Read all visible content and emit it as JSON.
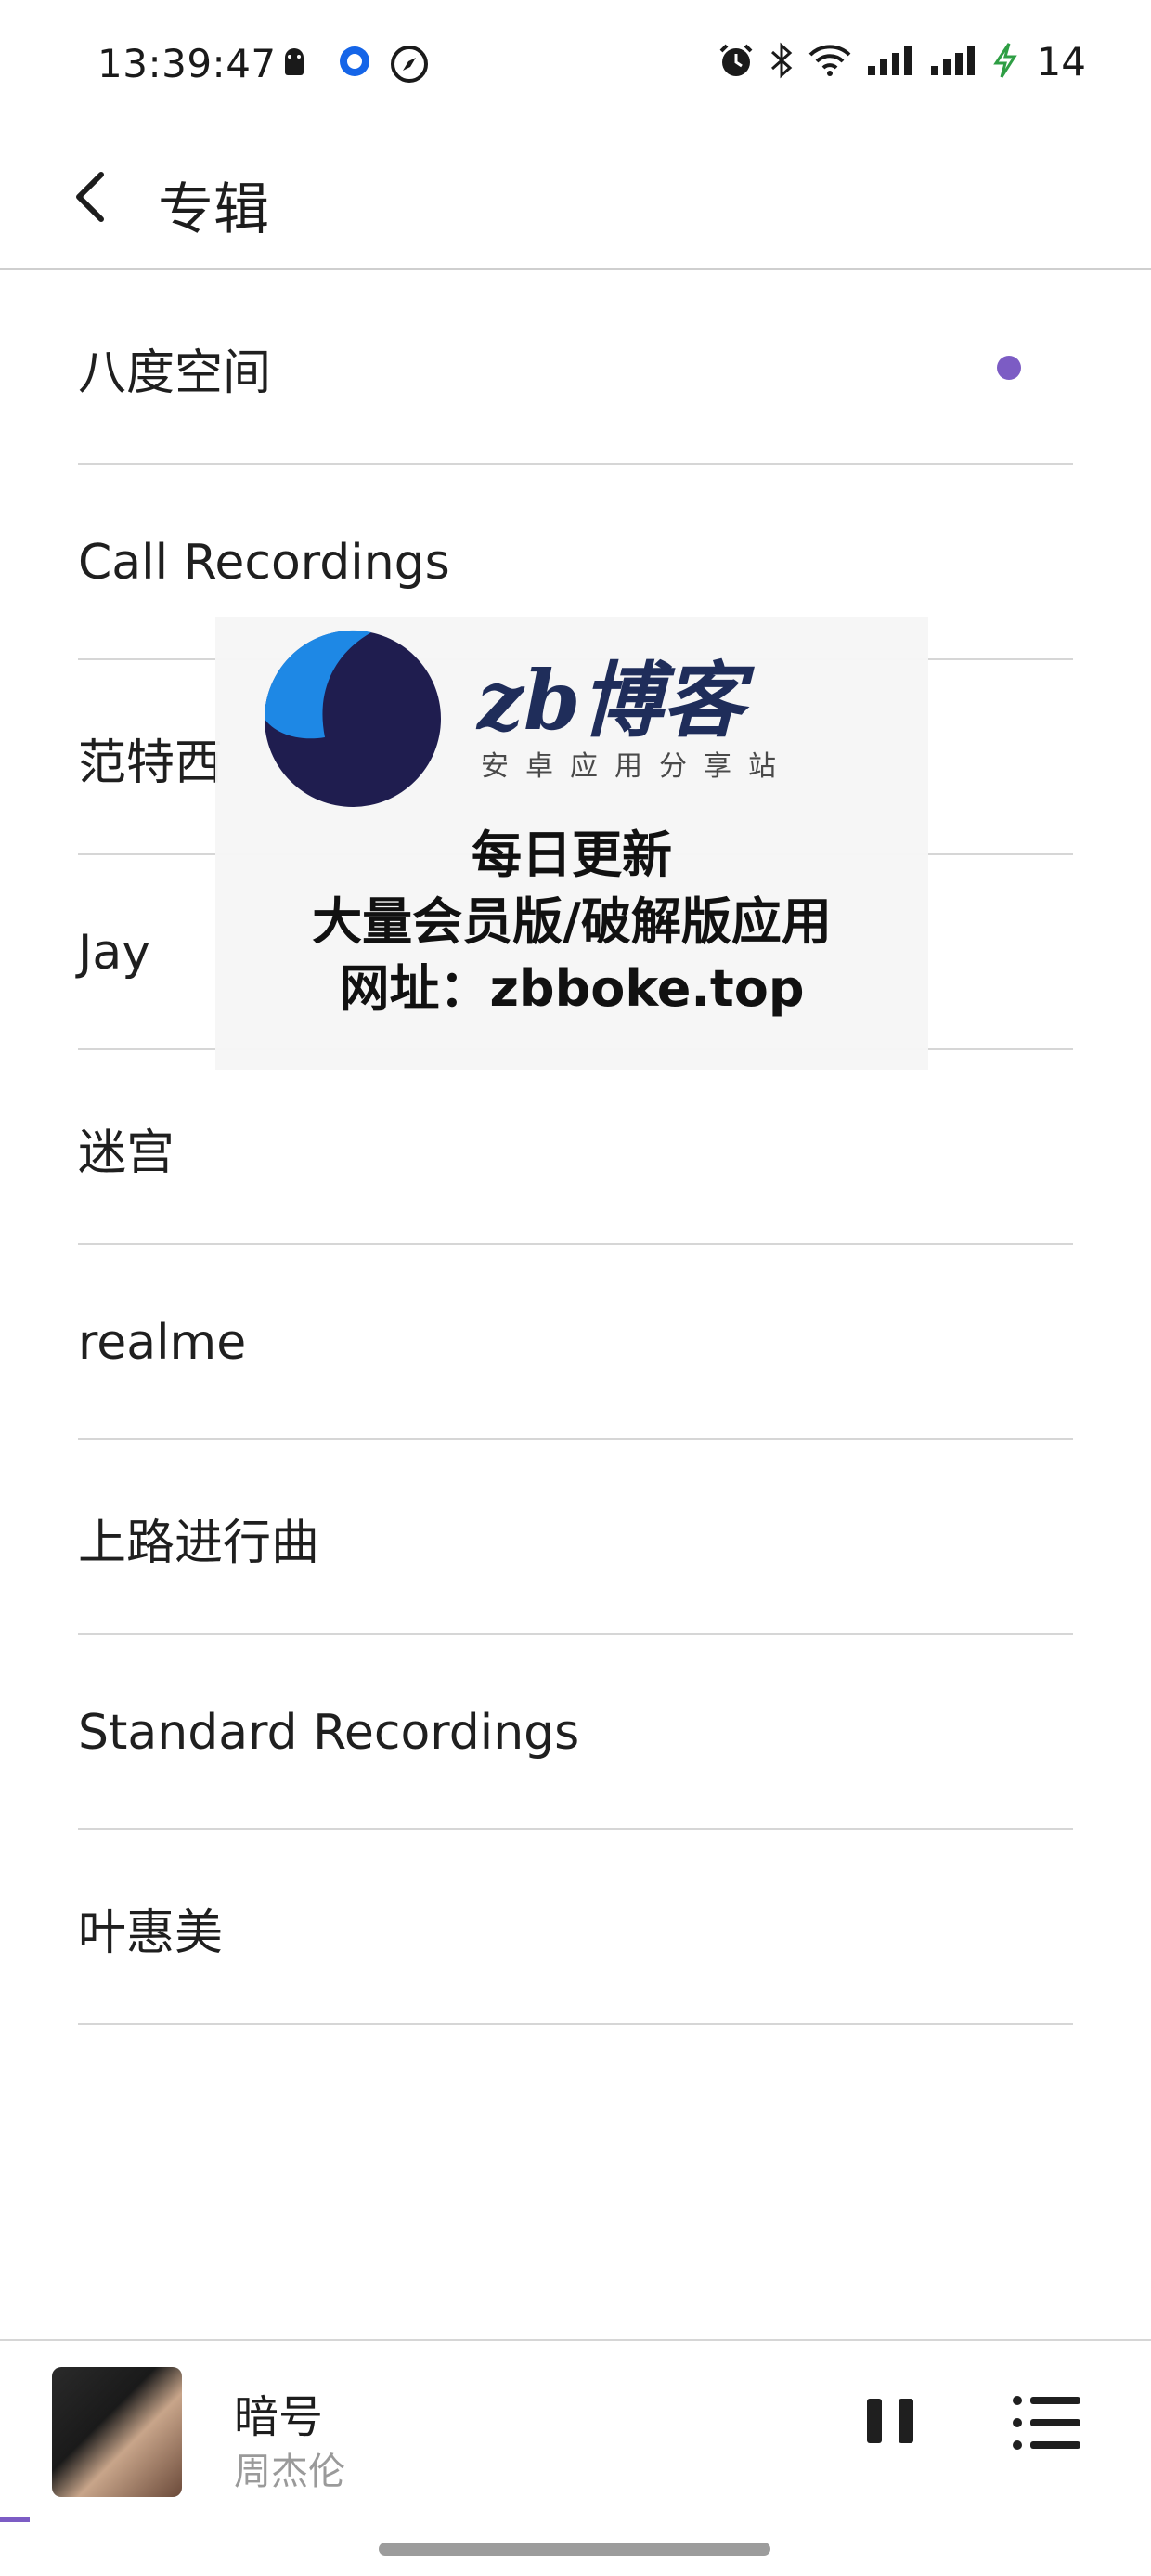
{
  "status_bar": {
    "time": "13:39:47",
    "battery_level": "14",
    "left_icons": [
      "android-icon",
      "circle-app-icon",
      "compass-icon"
    ],
    "right_icons": [
      "alarm-icon",
      "bluetooth-icon",
      "wifi-icon",
      "signal-icon",
      "signal-icon",
      "charging-icon"
    ]
  },
  "app_bar": {
    "title": "专辑",
    "back_icon": "back-arrow-icon"
  },
  "albums": [
    {
      "label": "八度空间",
      "playing": true
    },
    {
      "label": "Call Recordings",
      "playing": false
    },
    {
      "label": "范特西",
      "playing": false
    },
    {
      "label": "Jay",
      "playing": false
    },
    {
      "label": "迷宫",
      "playing": false
    },
    {
      "label": "realme",
      "playing": false
    },
    {
      "label": "上路进行曲",
      "playing": false
    },
    {
      "label": "Standard Recordings",
      "playing": false
    },
    {
      "label": "叶惠美",
      "playing": false
    }
  ],
  "watermark": {
    "brand": "zb博客",
    "subtitle": "安卓应用分享站",
    "line1": "每日更新",
    "line2": "大量会员版/破解版应用",
    "line3": "网址：zbboke.top"
  },
  "player": {
    "song_title": "暗号",
    "artist": "周杰伦",
    "pause_icon": "pause-icon",
    "queue_icon": "queue-list-icon"
  },
  "colors": {
    "accent": "#7c5cc4",
    "divider": "#d6d6d6",
    "watermark_blue": "#1e88e5",
    "watermark_navy": "#1f2d5a"
  }
}
